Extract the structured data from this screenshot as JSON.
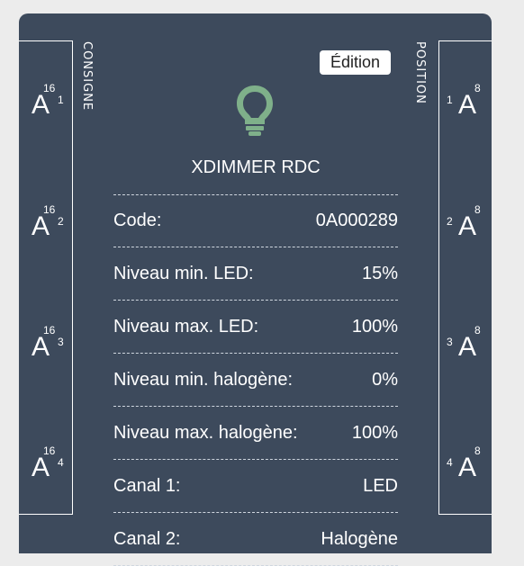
{
  "device": {
    "title": "XDIMMER RDC",
    "icon": "lightbulb-icon",
    "icon_color": "#7fb08a",
    "edit_label": "Édition"
  },
  "left_strip": {
    "label": "CONSIGNE",
    "ports": [
      {
        "letter": "A",
        "sup": "16",
        "sub": "1"
      },
      {
        "letter": "A",
        "sup": "16",
        "sub": "2"
      },
      {
        "letter": "A",
        "sup": "16",
        "sub": "3"
      },
      {
        "letter": "A",
        "sup": "16",
        "sub": "4"
      }
    ]
  },
  "right_strip": {
    "label": "POSITION",
    "ports": [
      {
        "letter": "A",
        "sup": "8",
        "pre": "1"
      },
      {
        "letter": "A",
        "sup": "8",
        "pre": "2"
      },
      {
        "letter": "A",
        "sup": "8",
        "pre": "3"
      },
      {
        "letter": "A",
        "sup": "8",
        "pre": "4"
      }
    ]
  },
  "properties": [
    {
      "label": "Code:",
      "value": "0A000289"
    },
    {
      "label": "Niveau min. LED:",
      "value": "15%"
    },
    {
      "label": "Niveau max. LED:",
      "value": "100%"
    },
    {
      "label": "Niveau min. halogène:",
      "value": "0%"
    },
    {
      "label": "Niveau max. halogène:",
      "value": "100%"
    },
    {
      "label": "Canal 1:",
      "value": "LED"
    },
    {
      "label": "Canal 2:",
      "value": "Halogène"
    }
  ],
  "colors": {
    "card_background": "#3d4a5c",
    "page_background": "#ececec"
  }
}
